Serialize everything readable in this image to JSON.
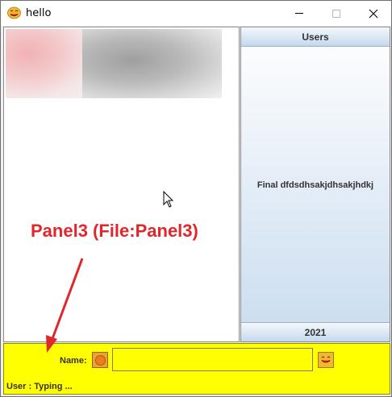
{
  "window": {
    "title": "hello",
    "icon": "smiley-icon",
    "controls": [
      "minimize-icon",
      "maximize-icon",
      "close-icon"
    ]
  },
  "left_panel": {
    "image": "blurred-photo",
    "annotation": "Panel3 (File:Panel3)",
    "annotation_color": "#e0272c"
  },
  "right_panel": {
    "header": "Users",
    "body_text": "Final dfdsdhsakjdhsakjhdkj",
    "footer": "2021"
  },
  "bottom_panel": {
    "background": "#ffff00",
    "name_label": "Name:",
    "name_value": "",
    "status": "User : Typing ..."
  }
}
